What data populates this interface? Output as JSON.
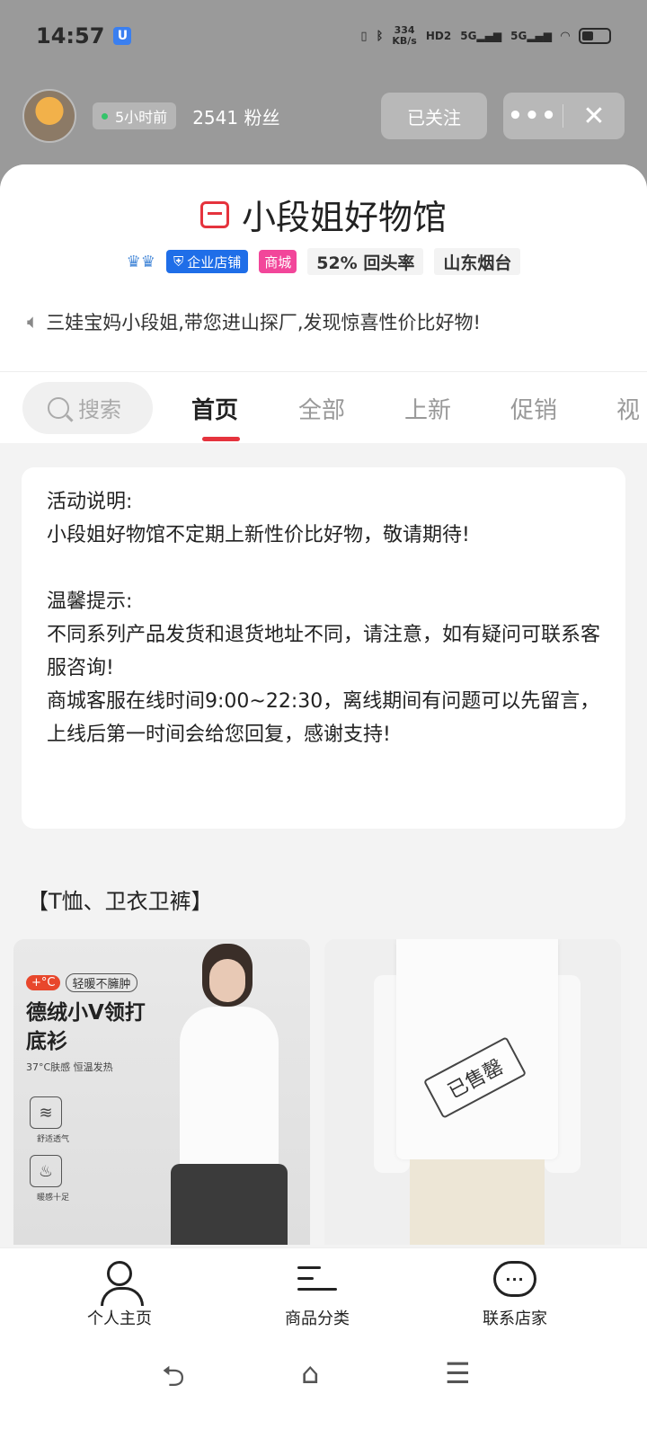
{
  "status_bar": {
    "time": "14:57",
    "speed_value": "334",
    "speed_unit": "KB/s",
    "hd": "HD2",
    "net1": "5G",
    "net2": "5G"
  },
  "shop_top": {
    "last_active": "5小时前",
    "fans": "2541 粉丝",
    "follow_label": "已关注",
    "more_label": "•••",
    "close_label": "✕"
  },
  "shop": {
    "name": "小段姐好物馆",
    "badge_enterprise": "企业店铺",
    "badge_mall": "商城",
    "repurchase": "52% 回头率",
    "location": "山东烟台",
    "notice": "三娃宝妈小段姐,带您进山探厂,发现惊喜性价比好物!"
  },
  "tabs": {
    "search_label": "搜索",
    "items": [
      "首页",
      "全部",
      "上新",
      "促销",
      "视"
    ]
  },
  "activity": {
    "heading1": "活动说明:",
    "line1": "小段姐好物馆不定期上新性价比好物，敬请期待!",
    "heading2": "温馨提示:",
    "line2": "不同系列产品发货和退货地址不同，请注意，如有疑问可联系客服咨询!",
    "line3": "商城客服在线时间9:00~22:30，离线期间有问题可以先留言，上线后第一时间会给您回复，感谢支持!"
  },
  "section_title": "【T恤、卫衣卫裤】",
  "products": [
    {
      "temp_tag": "+°C",
      "warm_tag": "轻暖不臃肿",
      "headline": "德绒小V领打底衫",
      "subline": "37°C肤感 恒温发热",
      "feature1": "舒适透气",
      "feature2": "暖感十足"
    },
    {
      "sold_label": "已售罄"
    }
  ],
  "bottom_nav": {
    "profile": "个人主页",
    "category": "商品分类",
    "contact": "联系店家"
  }
}
